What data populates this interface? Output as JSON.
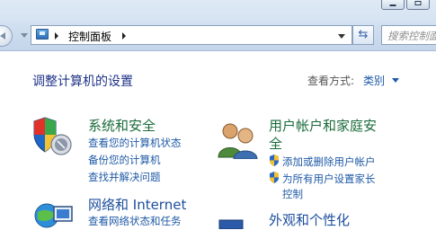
{
  "window": {
    "title_buttons": [
      "minimize",
      "maximize"
    ]
  },
  "navbar": {
    "address_text": "控制面板",
    "search_placeholder": "搜索控制面"
  },
  "content": {
    "page_title": "调整计算机的设置",
    "view_label": "查看方式:",
    "view_value": "类别",
    "categories": [
      {
        "title": "系统和安全",
        "icon": "shield-icon",
        "links": [
          "查看您的计算机状态",
          "备份您的计算机",
          "查找并解决问题"
        ]
      },
      {
        "title_line1": "用户帐户和家庭安",
        "title_line2": "全",
        "icon": "users-icon",
        "links": [
          "添加或删除用户帐户",
          "为所有用户设置家长",
          "控制"
        ]
      },
      {
        "title": "网络和 Internet",
        "icon": "network-icon",
        "links": [
          "查看网络状态和任务"
        ]
      },
      {
        "title": "外观和个性化",
        "icon": "appearance-icon",
        "links": []
      }
    ]
  },
  "colors": {
    "link_blue": "#1f5aa6",
    "category_green": "#1a6b3a",
    "title_blue": "#1e3287"
  }
}
